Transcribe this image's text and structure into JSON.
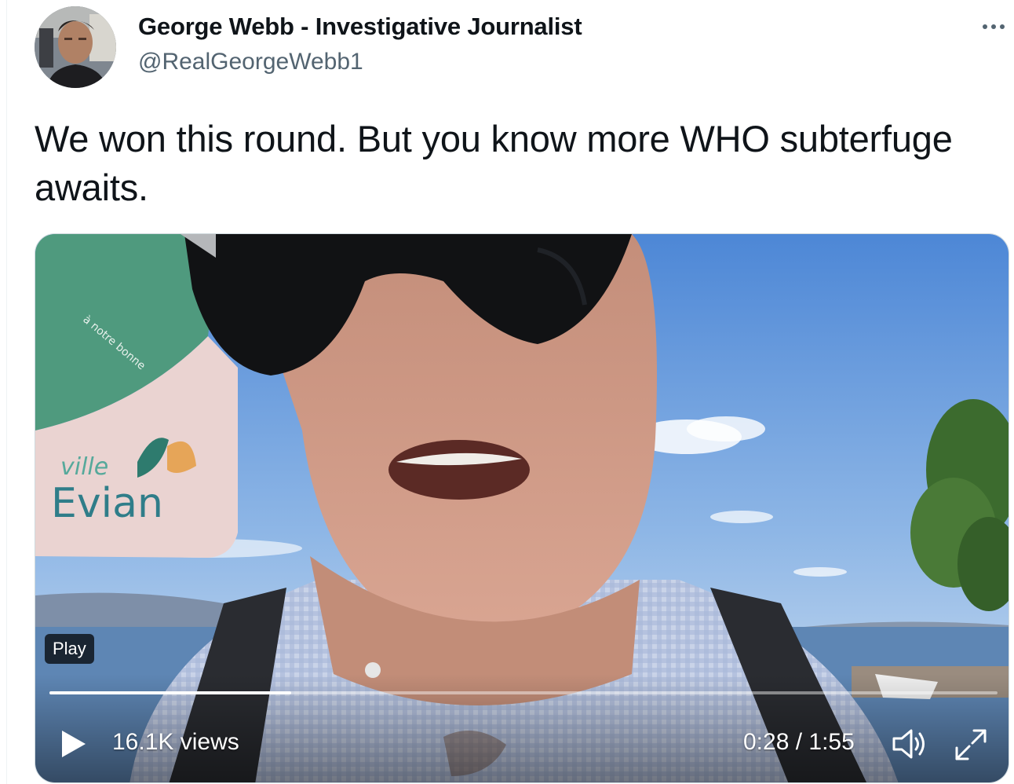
{
  "author": {
    "name": "George Webb - Investigative Journalist",
    "handle": "@RealGeorgeWebb1"
  },
  "tweet": {
    "text": "We won this round. But you know more WHO subterfuge awaits."
  },
  "video": {
    "play_label": "Play",
    "views": "16.1K views",
    "time": "0:28 / 1:55",
    "progress": 0.255,
    "sign_text_top": "ville",
    "sign_text_bottom": "Evian",
    "bin_text": "à notre bonne"
  },
  "icons": {
    "more": "more-icon",
    "play": "play-icon",
    "volume": "volume-icon",
    "fullscreen": "fullscreen-icon"
  }
}
